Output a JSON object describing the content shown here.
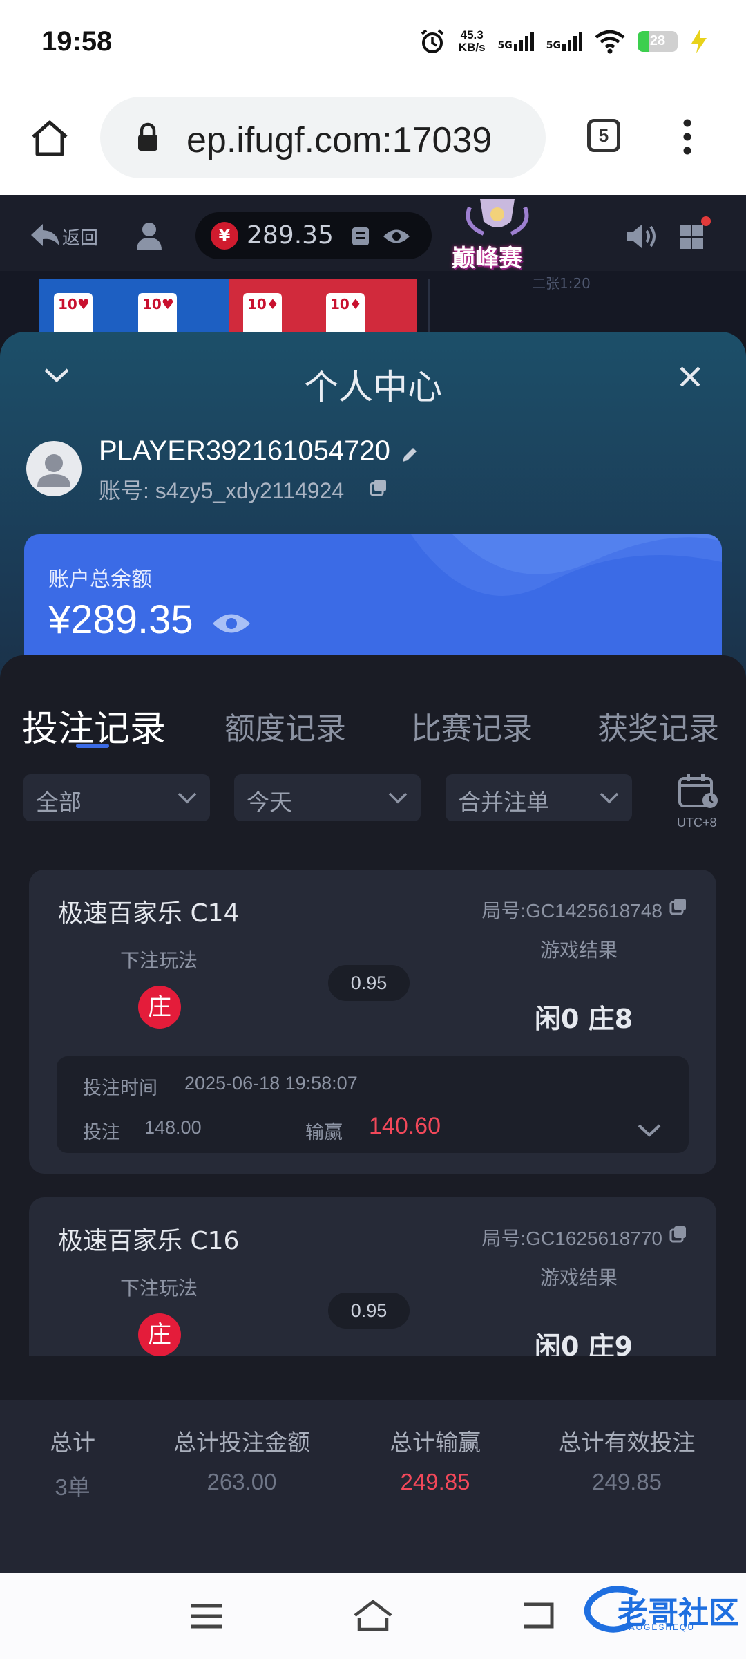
{
  "status_bar": {
    "time": "19:58",
    "net_speed": "45.3",
    "net_unit": "KB/s",
    "sig1_label": "5G",
    "sig2_label": "5G",
    "battery": "28",
    "battery_level": 0.28
  },
  "browser": {
    "url": "ep.ifugf.com:17039",
    "tab_count": "5"
  },
  "game_header": {
    "back_label": "返回",
    "balance": "289.35",
    "yen_symbol": "¥",
    "badge_text": "巅峰赛",
    "table_hint": "二张1:20"
  },
  "modal": {
    "title": "个人中心",
    "player_name": "PLAYER392161054720",
    "account": "账号: s4zy5_xdy2114924",
    "balance_label": "账户总余额",
    "balance_amount": "¥289.35"
  },
  "tabs": [
    {
      "label": "投注记录",
      "active": true
    },
    {
      "label": "额度记录",
      "active": false
    },
    {
      "label": "比赛记录",
      "active": false
    },
    {
      "label": "获奖记录",
      "active": false
    }
  ],
  "filters": [
    {
      "value": "全部"
    },
    {
      "value": "今天"
    },
    {
      "value": "合并注单"
    }
  ],
  "utc_label": "UTC+8",
  "records": [
    {
      "title": "极速百家乐 C14",
      "round": "局号:GC1425618748",
      "bet_label": "下注玩法",
      "bet_side": "庄",
      "odds": "0.95",
      "result_label": "游戏结果",
      "result": "闲0 庄8",
      "time_label": "投注时间",
      "time": "2025-06-18 19:58:07",
      "stake_label": "投注",
      "stake": "148.00",
      "win_label": "输赢",
      "win": "140.60"
    },
    {
      "title": "极速百家乐 C16",
      "round": "局号:GC1625618770",
      "bet_label": "下注玩法",
      "bet_side": "庄",
      "odds": "0.95",
      "result_label": "游戏结果",
      "result": "闲0 庄9"
    }
  ],
  "totals": {
    "headers": [
      "总计",
      "总计投注金额",
      "总计输赢",
      "总计有效投注"
    ],
    "values": [
      "3单",
      "263.00",
      "249.85",
      "249.85"
    ]
  },
  "watermark": {
    "text": "老哥社区",
    "sub": "LAOGESHEQU"
  },
  "colors": {
    "accent": "#3b6be6",
    "win": "#f2485a",
    "banker": "#e41c3a"
  }
}
